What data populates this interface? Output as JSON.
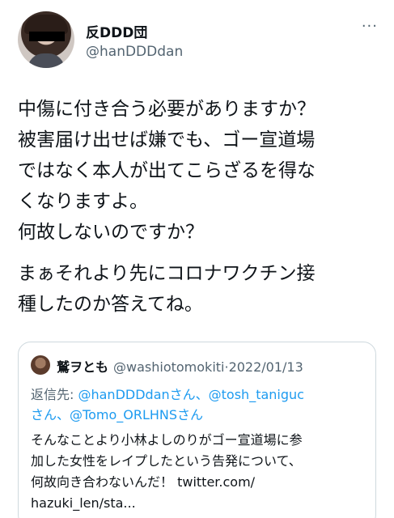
{
  "author": {
    "display_name": "反DDD団",
    "handle": "@hanDDDdan",
    "avatar_icon": "profile-photo-icon",
    "more_icon": "···"
  },
  "tweet": {
    "paragraph1": [
      "中傷に付き合う必要がありますか？",
      "被害届け出せば嫌でも、ゴー宣道場",
      "ではなく本人が出てこらざるを得な",
      "くなりますよ。",
      "何故しないのですか？"
    ],
    "paragraph2": [
      "まぁそれより先にコロナワクチン接",
      "種したのか答えてね。"
    ]
  },
  "quoted_tweet": {
    "display_name": "鷲ヲとも",
    "handle": "@washiotomokiti",
    "date": "·2022/01/13",
    "reply_prefix": "返信先: ",
    "mention1": "@hanDDDdan",
    "san1": "さん、",
    "mention2": "@tosh_taniguc",
    "line2_san": "さん、",
    "mention3": "@Tomo_ORLHNS",
    "san3": "さん",
    "body": [
      "そんなことより小林よしのりがゴー宣道場に参",
      "加した女性をレイプしたという告発について、",
      "何故向き合わないんだ！ twitter.com/",
      "hazuki_len/sta..."
    ]
  },
  "colors": {
    "text": "#0f1419",
    "secondary": "#536471",
    "link": "#1d9bf0",
    "border": "#cfd9de"
  }
}
